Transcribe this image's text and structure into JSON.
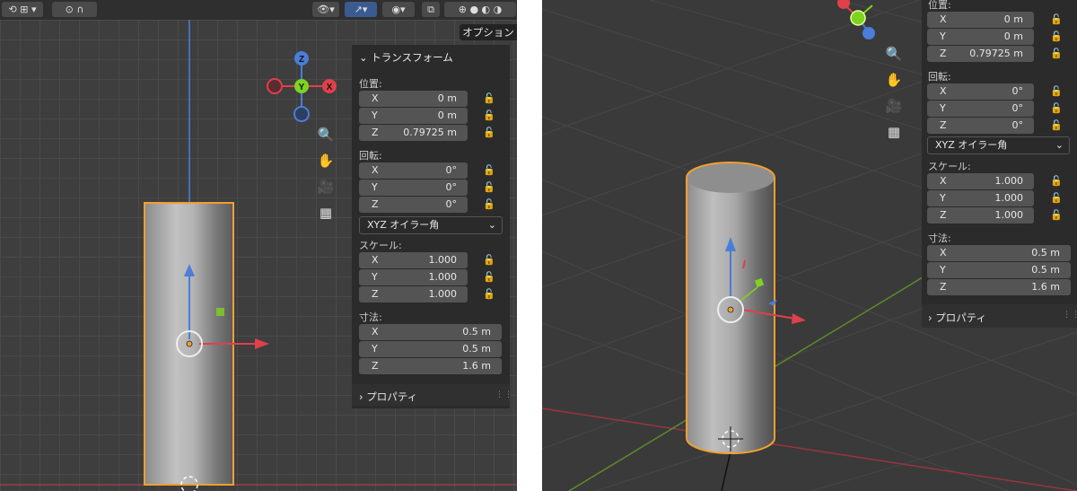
{
  "header": {
    "options_label": "オプション"
  },
  "left_panel": {
    "transform_title": "トランスフォーム",
    "location_label": "位置:",
    "location": [
      {
        "axis": "X",
        "value": "0 m"
      },
      {
        "axis": "Y",
        "value": "0 m"
      },
      {
        "axis": "Z",
        "value": "0.79725 m"
      }
    ],
    "rotation_label": "回転:",
    "rotation": [
      {
        "axis": "X",
        "value": "0°"
      },
      {
        "axis": "Y",
        "value": "0°"
      },
      {
        "axis": "Z",
        "value": "0°"
      }
    ],
    "rotation_mode": "XYZ オイラー角",
    "scale_label": "スケール:",
    "scale": [
      {
        "axis": "X",
        "value": "1.000"
      },
      {
        "axis": "Y",
        "value": "1.000"
      },
      {
        "axis": "Z",
        "value": "1.000"
      }
    ],
    "dimensions_label": "寸法:",
    "dimensions": [
      {
        "axis": "X",
        "value": "0.5 m"
      },
      {
        "axis": "Y",
        "value": "0.5 m"
      },
      {
        "axis": "Z",
        "value": "1.6 m"
      }
    ],
    "properties_label": "プロパティ"
  },
  "right_panel": {
    "location_label": "位置:",
    "location": [
      {
        "axis": "X",
        "value": "0 m"
      },
      {
        "axis": "Y",
        "value": "0 m"
      },
      {
        "axis": "Z",
        "value": "0.79725 m"
      }
    ],
    "rotation_label": "回転:",
    "rotation": [
      {
        "axis": "X",
        "value": "0°"
      },
      {
        "axis": "Y",
        "value": "0°"
      },
      {
        "axis": "Z",
        "value": "0°"
      }
    ],
    "rotation_mode": "XYZ オイラー角",
    "scale_label": "スケール:",
    "scale": [
      {
        "axis": "X",
        "value": "1.000"
      },
      {
        "axis": "Y",
        "value": "1.000"
      },
      {
        "axis": "Z",
        "value": "1.000"
      }
    ],
    "dimensions_label": "寸法:",
    "dimensions": [
      {
        "axis": "X",
        "value": "0.5 m"
      },
      {
        "axis": "Y",
        "value": "0.5 m"
      },
      {
        "axis": "Z",
        "value": "1.6 m"
      }
    ],
    "properties_label": "プロパティ"
  },
  "gizmo": {
    "z": "Z",
    "y": "Y",
    "x": "X"
  },
  "icons": {
    "zoom": "zoom-icon",
    "pan": "hand-icon",
    "camera": "camera-icon",
    "ortho": "grid-icon",
    "lock": "lock-icon"
  },
  "colors": {
    "selection_outline": "#f0a030",
    "axis_x": "#e0404a",
    "axis_y": "#7ed321",
    "axis_z": "#4a7ed8",
    "panel_bg": "#2b2b2b",
    "field_bg": "#545454"
  }
}
